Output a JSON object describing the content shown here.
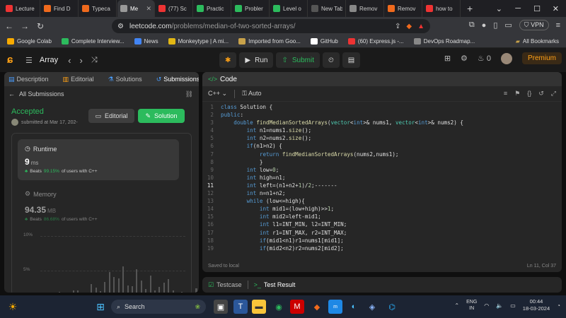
{
  "browser": {
    "tabs": [
      {
        "label": "Lecture",
        "color": "#e33"
      },
      {
        "label": "Find D",
        "color": "#f06a1d"
      },
      {
        "label": "Typeca",
        "color": "#f06a1d"
      },
      {
        "label": "Me",
        "color": "#999",
        "active": true
      },
      {
        "label": "(77) Sc",
        "color": "#e33"
      },
      {
        "label": "Practic",
        "color": "#2cbb5d"
      },
      {
        "label": "Probler",
        "color": "#2cbb5d"
      },
      {
        "label": "Level o",
        "color": "#2cbb5d"
      },
      {
        "label": "New Tab",
        "color": "#555"
      },
      {
        "label": "Remov",
        "color": "#888"
      },
      {
        "label": "Remov",
        "color": "#f06a1d"
      },
      {
        "label": "how to",
        "color": "#e33"
      }
    ],
    "url_host": "leetcode.com",
    "url_path": "/problems/median-of-two-sorted-arrays/",
    "vpn": "VPN",
    "bookmarks": [
      {
        "label": "Google Colab",
        "color": "#f9ab00"
      },
      {
        "label": "Complete Interview...",
        "color": "#2cbb5d"
      },
      {
        "label": "News",
        "color": "#4285f4"
      },
      {
        "label": "Monkeytype | A mi...",
        "color": "#e2b714"
      },
      {
        "label": "Imported from Goo...",
        "color": "#c8a24a"
      },
      {
        "label": "GitHub",
        "color": "#fff"
      },
      {
        "label": "(60) Express.js -...",
        "color": "#e33"
      },
      {
        "label": "DevOps Roadmap...",
        "color": "#888"
      }
    ],
    "all_bookmarks": "All Bookmarks"
  },
  "leetcode": {
    "problem_list": "Array",
    "run": "Run",
    "submit": "Submit",
    "streak": "0",
    "premium": "Premium"
  },
  "left": {
    "tabs": [
      "Description",
      "Editorial",
      "Solutions",
      "Submissions"
    ],
    "all_submissions": "All Submissions",
    "status": "Accepted",
    "submitted": "submitted at Mar 17, 202-",
    "editorial_btn": "Editorial",
    "solution_btn": "Solution",
    "runtime": {
      "title": "Runtime",
      "value": "9",
      "unit": "ms",
      "beats_prefix": "Beats",
      "pct": "99.15%",
      "beats_suffix": "of users with C++"
    },
    "memory": {
      "title": "Memory",
      "value": "94.35",
      "unit": "MB",
      "beats_prefix": "Beats",
      "pct": "86.68%",
      "beats_suffix": "of users with C++"
    },
    "chart": {
      "ticks": [
        "10%",
        "5%"
      ]
    }
  },
  "chart_data": {
    "type": "bar",
    "title": "",
    "yticks": [
      "10%",
      "5%"
    ],
    "values": [
      0.4,
      0.7,
      0.2,
      0.5,
      1.0,
      0.9,
      0.3,
      0.6,
      2.0,
      1.4,
      0.8,
      2.3,
      4.0,
      3.2,
      3.0,
      5.0,
      1.8,
      1.6,
      4.5,
      2.6,
      1.2,
      3.4,
      0.9,
      1.5,
      2.2,
      2.8,
      1.0,
      0.5,
      0.7,
      0.3,
      0.6,
      0.4
    ],
    "ylim": [
      0,
      10
    ]
  },
  "code": {
    "header": "Code",
    "language": "C++",
    "mode": "Auto",
    "saved": "Saved to local",
    "position": "Ln 11, Col 37",
    "lines": [
      "class Solution {",
      "public:",
      "    double findMedianSortedArrays(vector<int>& nums1, vector<int>& nums2) {",
      "        int n1=nums1.size();",
      "        int n2=nums2.size();",
      "        if(n1>n2) {",
      "            return findMedianSortedArrays(nums2,nums1);",
      "            }",
      "        int low=0;",
      "        int high=n1;",
      "        int left=(n1+n2+1)/2;-------",
      "        int n=n1+n2;",
      "        while (low<=high){",
      "            int mid1=(low+high)>>1;",
      "            int mid2=left-mid1;",
      "            int l1=INT_MIN, l2=INT_MIN;",
      "            int r1=INT_MAX, r2=INT_MAX;",
      "            if(mid1<n1)r1=nums1[mid1];",
      "            if(mid2<n2)r2=nums2[mid2];"
    ]
  },
  "bottom": {
    "testcase": "Testcase",
    "result": "Test Result"
  },
  "taskbar": {
    "search": "Search",
    "lang1": "ENG",
    "lang2": "IN",
    "time": "00:44",
    "date": "18-03-2024"
  }
}
